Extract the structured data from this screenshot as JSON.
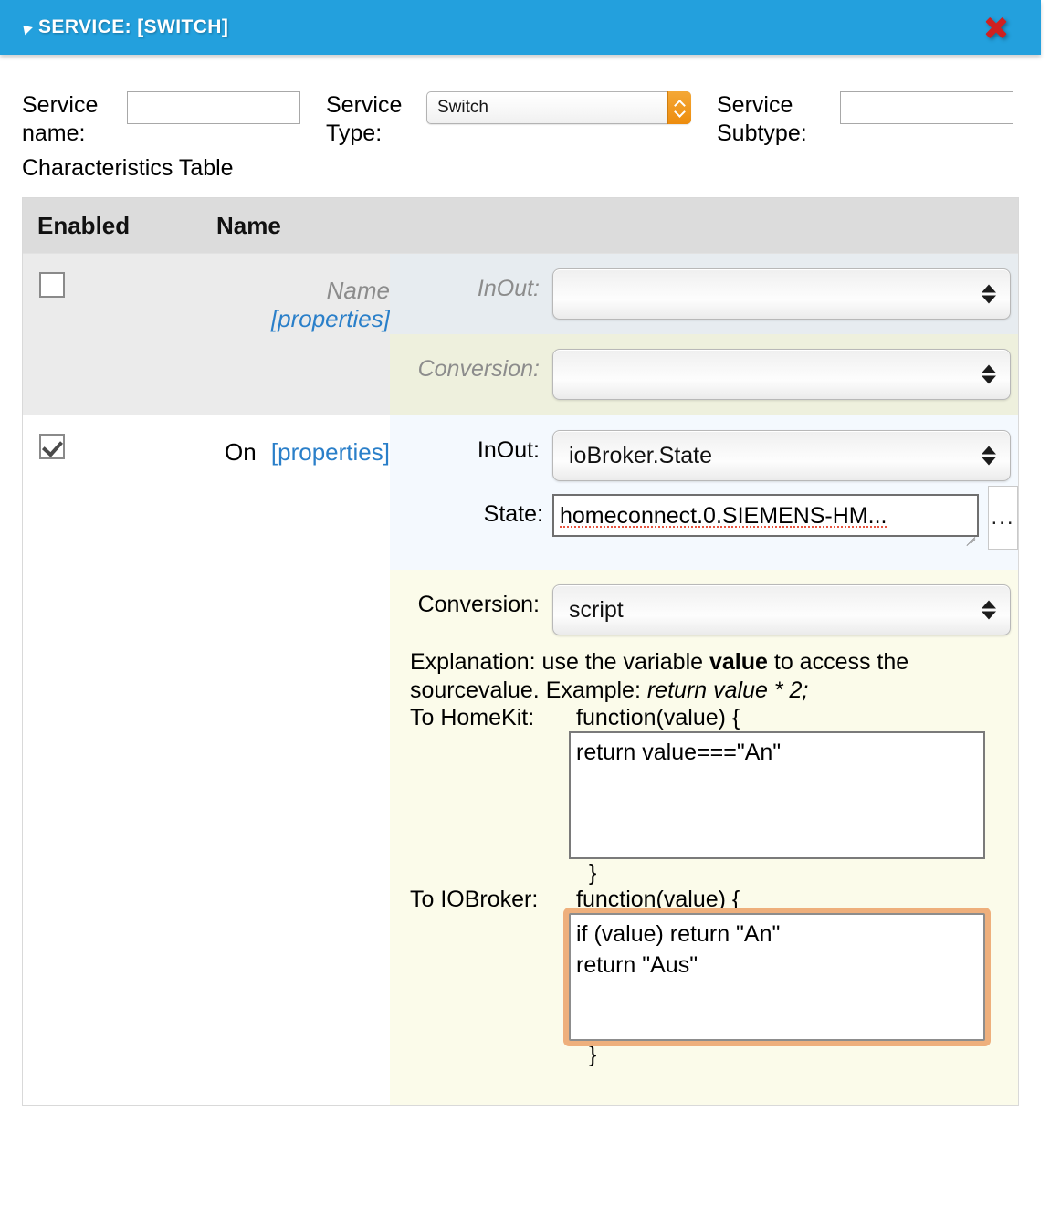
{
  "window": {
    "title": "SERVICE: [SWITCH]",
    "collapse_icon": "triangle-collapse-icon",
    "close_icon": "close-x-icon",
    "accent_color": "#23a0dd",
    "close_color": "#cf2020"
  },
  "form": {
    "service_name_label": "Service name:",
    "service_name_value": "",
    "service_name_placeholder": "",
    "service_type_label": "Service Type:",
    "service_type_value": "Switch",
    "service_type_options": [
      "Switch"
    ],
    "service_subtype_label": "Service Subtype:",
    "service_subtype_value": "",
    "service_subtype_placeholder": "",
    "select_accent_color": "#ed8c0d"
  },
  "table": {
    "caption": "Characteristics Table",
    "columns": [
      "Enabled",
      "Name"
    ],
    "rows": [
      {
        "enabled": false,
        "checkbox_state": "unchecked",
        "name": "Name",
        "properties_link": "[properties]",
        "inout_label": "InOut:",
        "inout_value": "",
        "conversion_label": "Conversion:",
        "conversion_value": "",
        "disabled": true
      },
      {
        "enabled": true,
        "checkbox_state": "checked",
        "name": "On",
        "properties_link": "[properties]",
        "inout_label": "InOut:",
        "inout_value": "ioBroker.State",
        "state_label": "State:",
        "state_value": "homeconnect.0.SIEMENS-HM...",
        "state_browse_button": "...",
        "conversion_label": "Conversion:",
        "conversion_value": "script",
        "explanation_prefix": "Explanation: use the variable ",
        "explanation_var": "value",
        "explanation_mid": " to access the sourcevalue. Example: ",
        "explanation_example": "return value * 2;",
        "to_homekit_label": "To HomeKit:",
        "to_homekit_signature": "function(value) {",
        "to_homekit_code": "return value===\"An\"",
        "to_homekit_close": "}",
        "to_iobroker_label": "To IOBroker:",
        "to_iobroker_signature": "function(value) {",
        "to_iobroker_code": "if (value) return \"An\"\nreturn \"Aus\"",
        "to_iobroker_close": "}",
        "focused_field": "to_iobroker_code",
        "focus_ring_color": "#eeaf7c",
        "disabled": false
      }
    ]
  }
}
